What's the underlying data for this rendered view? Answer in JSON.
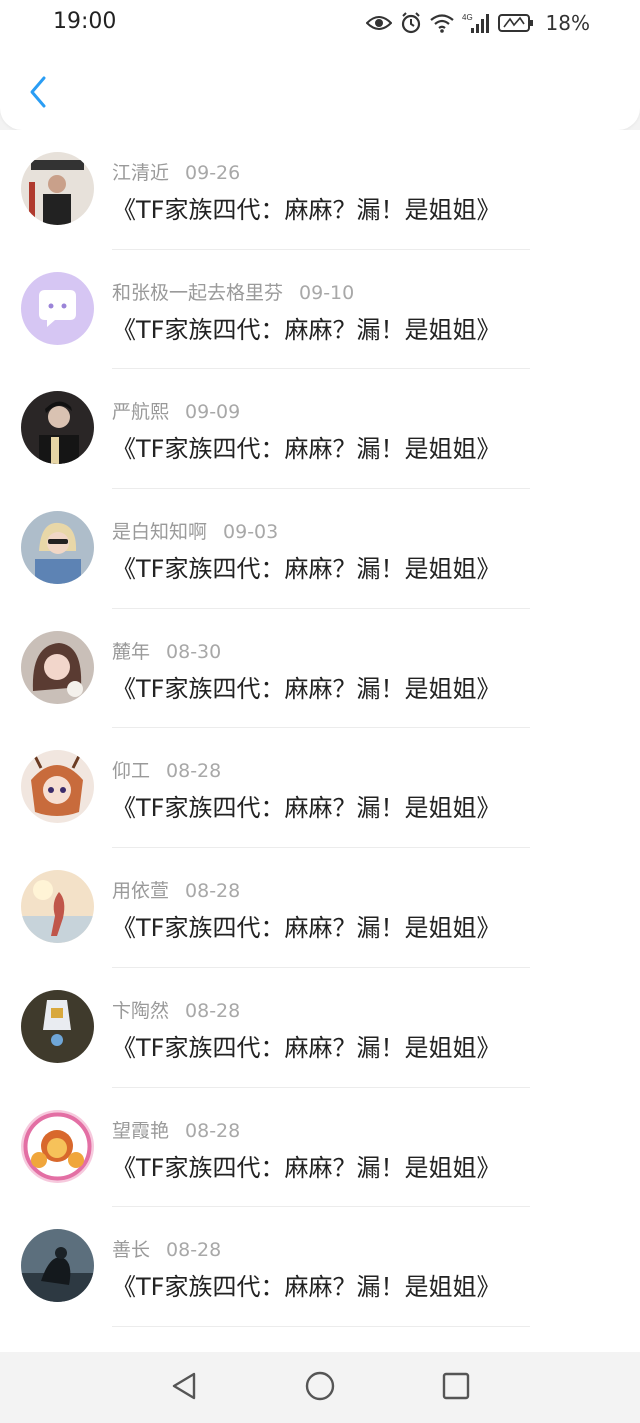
{
  "status_bar": {
    "time": "19:00",
    "icons": [
      "eye-icon",
      "alarm-icon",
      "wifi-icon",
      "signal-4g-icon",
      "battery-icon"
    ],
    "network_label": "4G",
    "battery_percent": "18%"
  },
  "header": {
    "back_icon": "chevron-left-icon",
    "accent_color": "#2a9df4"
  },
  "items": [
    {
      "name": "江清近",
      "date": "09-26",
      "title": "《TF家族四代：麻麻？漏！是姐姐》"
    },
    {
      "name": "和张极一起去格里芬",
      "date": "09-10",
      "title": "《TF家族四代：麻麻？漏！是姐姐》"
    },
    {
      "name": "严航熙",
      "date": "09-09",
      "title": "《TF家族四代：麻麻？漏！是姐姐》"
    },
    {
      "name": "是白知知啊",
      "date": "09-03",
      "title": "《TF家族四代：麻麻？漏！是姐姐》"
    },
    {
      "name": "麓年",
      "date": "08-30",
      "title": "《TF家族四代：麻麻？漏！是姐姐》"
    },
    {
      "name": "仰工",
      "date": "08-28",
      "title": "《TF家族四代：麻麻？漏！是姐姐》"
    },
    {
      "name": "用依萱",
      "date": "08-28",
      "title": "《TF家族四代：麻麻？漏！是姐姐》"
    },
    {
      "name": "卞陶然",
      "date": "08-28",
      "title": "《TF家族四代：麻麻？漏！是姐姐》"
    },
    {
      "name": "望霞艳",
      "date": "08-28",
      "title": "《TF家族四代：麻麻？漏！是姐姐》"
    },
    {
      "name": "善长",
      "date": "08-28",
      "title": "《TF家族四代：麻麻？漏！是姐姐》"
    }
  ],
  "nav_bar": {
    "icons": [
      "back-triangle-icon",
      "home-circle-icon",
      "recents-square-icon"
    ]
  }
}
